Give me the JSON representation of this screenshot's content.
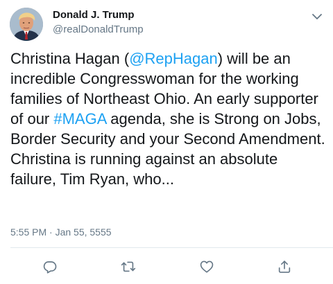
{
  "tweet": {
    "author": {
      "display_name": "Donald J. Trump",
      "handle": "@realDonaldTrump",
      "avatar_icon": "profile-photo"
    },
    "text": {
      "part1": "Christina Hagan (",
      "mention": "@RepHagan",
      "part2": ") will be an incredible Congresswoman for the working families of Northeast Ohio. An early supporter of our ",
      "hashtag": "#MAGA",
      "part3": " agenda, she is Strong on Jobs, Border Security and your Second Amendment. Christina is running against an absolute failure, Tim Ryan, who..."
    },
    "timestamp": "5:55 PM · Jan 55, 5555"
  },
  "actions": [
    {
      "name": "reply",
      "icon": "reply-icon"
    },
    {
      "name": "retweet",
      "icon": "retweet-icon"
    },
    {
      "name": "like",
      "icon": "heart-icon"
    },
    {
      "name": "share",
      "icon": "share-icon"
    }
  ],
  "colors": {
    "text": "#14171a",
    "secondary": "#657786",
    "link": "#1da1f2",
    "divider": "#e1e8ed"
  }
}
